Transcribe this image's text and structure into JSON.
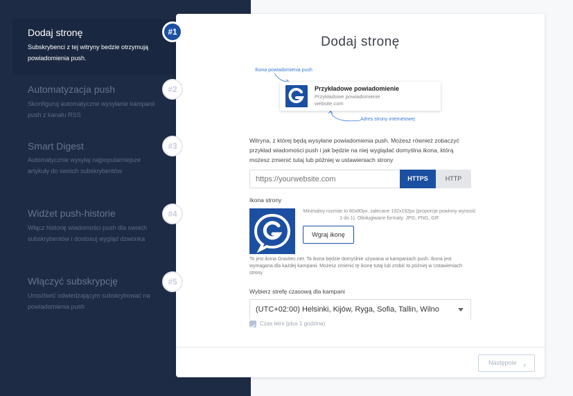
{
  "sidebar": {
    "steps": [
      {
        "badge": "#1",
        "title": "Dodaj stronę",
        "desc": "Subskrybenci z tej witryny bedzie otrzymują powiadomienia push."
      },
      {
        "badge": "#2",
        "title": "Automatyzacja push",
        "desc": "Skonfiguruj automatyczne wysyłanie kampanii push z kanału RSS"
      },
      {
        "badge": "#3",
        "title": "Smart Digest",
        "desc": "Automatycznie wysyłaj najpopularniejsze artykuły do swoich subskrybentów"
      },
      {
        "badge": "#4",
        "title": "Widżet push-historie",
        "desc": "Włącz historię wiadomości push dla swoich subskrybentów i dostosuj wygląd dzwonka"
      },
      {
        "badge": "#5",
        "title": "Włączyć subskrypcję",
        "desc": "Umożliwić odwiedzającym subskrybować na powiadomienia push"
      }
    ]
  },
  "card": {
    "title": "Dodaj stronę",
    "preview": {
      "icon_annotation": "Ikona powiadomienia push",
      "url_annotation": "Adres strony internetowej",
      "title": "Przykładowe powiadomienie",
      "body": "Przykładowe powiadomienie",
      "site": "website.com"
    },
    "description": "Witryna, z której będą wysyłane powiadomienia push. Możesz również zobaczyć przykład wiadomości push i jak będzie na niej wyglądać domyślna ikona, którą możesz zmienić tutaj lub później w ustawieniach strony",
    "url_input": {
      "placeholder": "https://yourwebsite.com"
    },
    "protocol": {
      "https": "HTTPS",
      "http": "HTTP",
      "selected": "HTTPS"
    },
    "icon_section": {
      "label": "Ikona strony",
      "hint": "Minimalny rozmiar to 80x80px, zalecane 192x192px (proporcje powinny wynosić 1 do 1). Obsługiwane formaty: JPG, PNG, GIF",
      "upload_label": "Wgraj ikonę",
      "note": "To jest ikona Gravitec.net. Ta ikona będzie domyślnie używana w kampaniach push. Ikona jest wymagana dla każdej kampanii. Możesz zmienić tę ikonę tutaj lub zrobić to później w Ustawieniach strony"
    },
    "timezone": {
      "label": "Wybierz strefę czasową dla kampani",
      "value": "(UTC+02:00) Helsinki, Kijów, Ryga, Sofia, Tallin, Wilno"
    },
    "dst": {
      "label": "Czas letni (plus 1 godzina)",
      "checked": true
    },
    "next_label": "Następnie"
  },
  "colors": {
    "sidebar": "#1d2b44",
    "accent": "#1b4fa1",
    "annotation": "#3a7bd5"
  }
}
